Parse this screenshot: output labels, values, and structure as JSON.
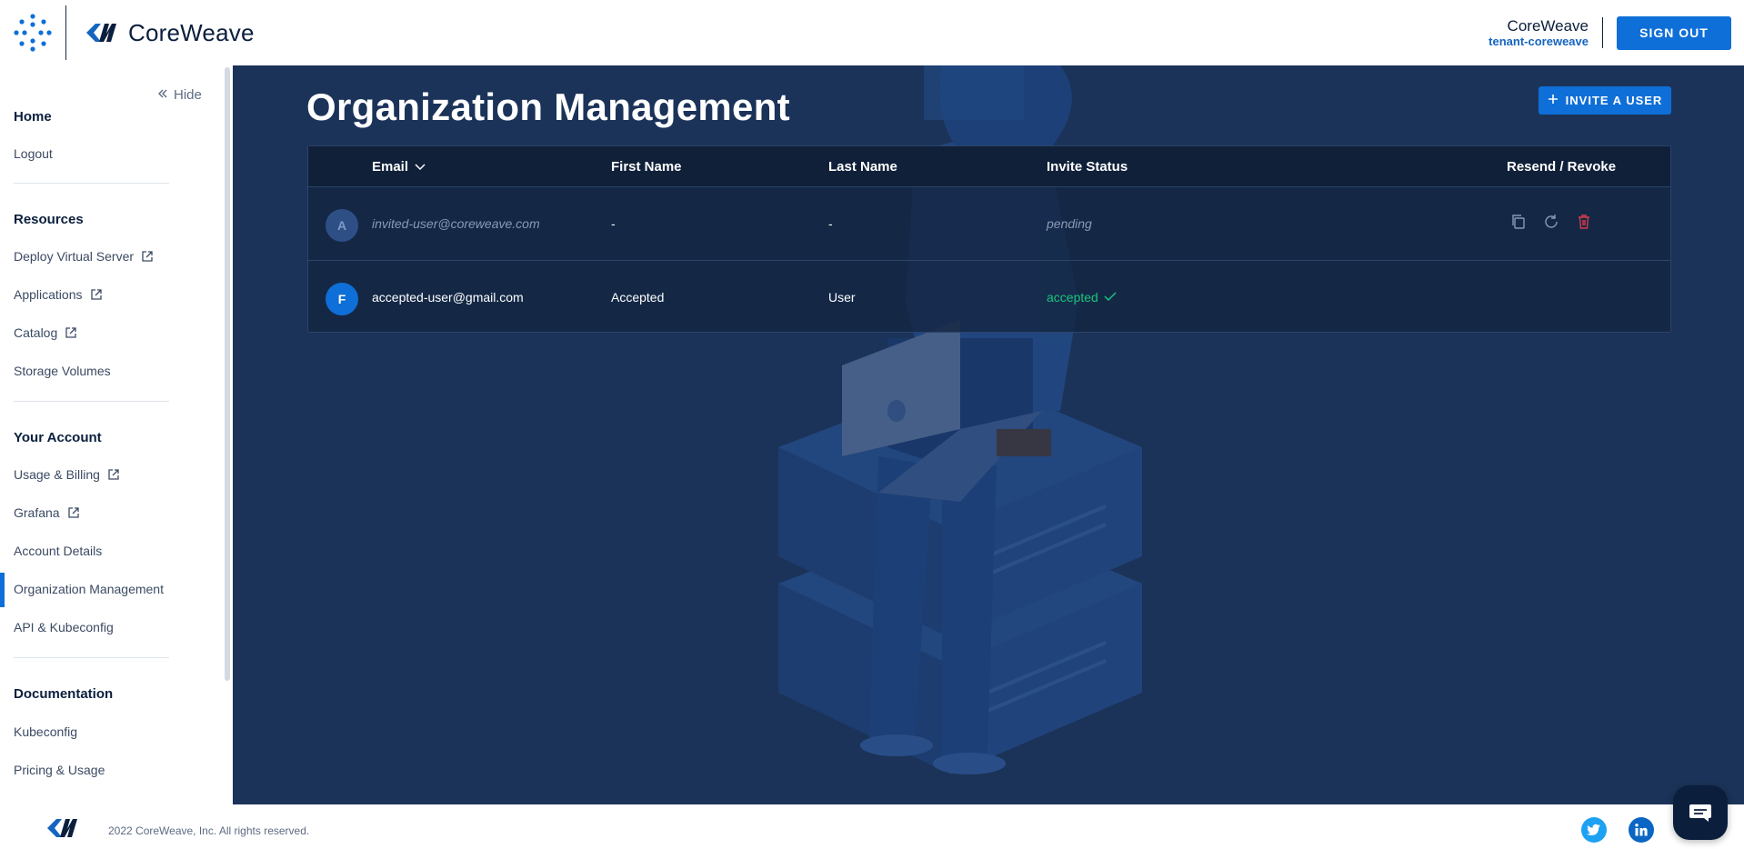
{
  "header": {
    "brand": "CoreWeave",
    "tenant_name": "CoreWeave",
    "tenant_id": "tenant-coreweave",
    "signout_label": "SIGN OUT"
  },
  "sidebar": {
    "hide_label": "Hide",
    "home": "Home",
    "logout": "Logout",
    "resources_heading": "Resources",
    "resources": [
      "Deploy Virtual Server",
      "Applications",
      "Catalog",
      "Storage Volumes"
    ],
    "account_heading": "Your Account",
    "account": [
      "Usage & Billing",
      "Grafana",
      "Account Details",
      "Organization Management",
      "API & Kubeconfig"
    ],
    "docs_heading": "Documentation",
    "docs": [
      "Kubeconfig",
      "Pricing & Usage"
    ]
  },
  "main": {
    "title": "Organization Management",
    "invite_label": "INVITE A USER",
    "columns": [
      "Email",
      "First Name",
      "Last Name",
      "Invite Status",
      "Resend / Revoke"
    ],
    "rows": [
      {
        "initial": "A",
        "email": "invited-user@coreweave.com",
        "first": "-",
        "last": "-",
        "status": "pending"
      },
      {
        "initial": "F",
        "email": "accepted-user@gmail.com",
        "first": "Accepted",
        "last": "User",
        "status": "accepted"
      }
    ]
  },
  "footer": {
    "copyright": "2022 CoreWeave, Inc. All rights reserved."
  },
  "colors": {
    "accent": "#0f6fd8",
    "background": "#1b3358",
    "accepted": "#19c47a",
    "revoke": "#d63b4a"
  }
}
